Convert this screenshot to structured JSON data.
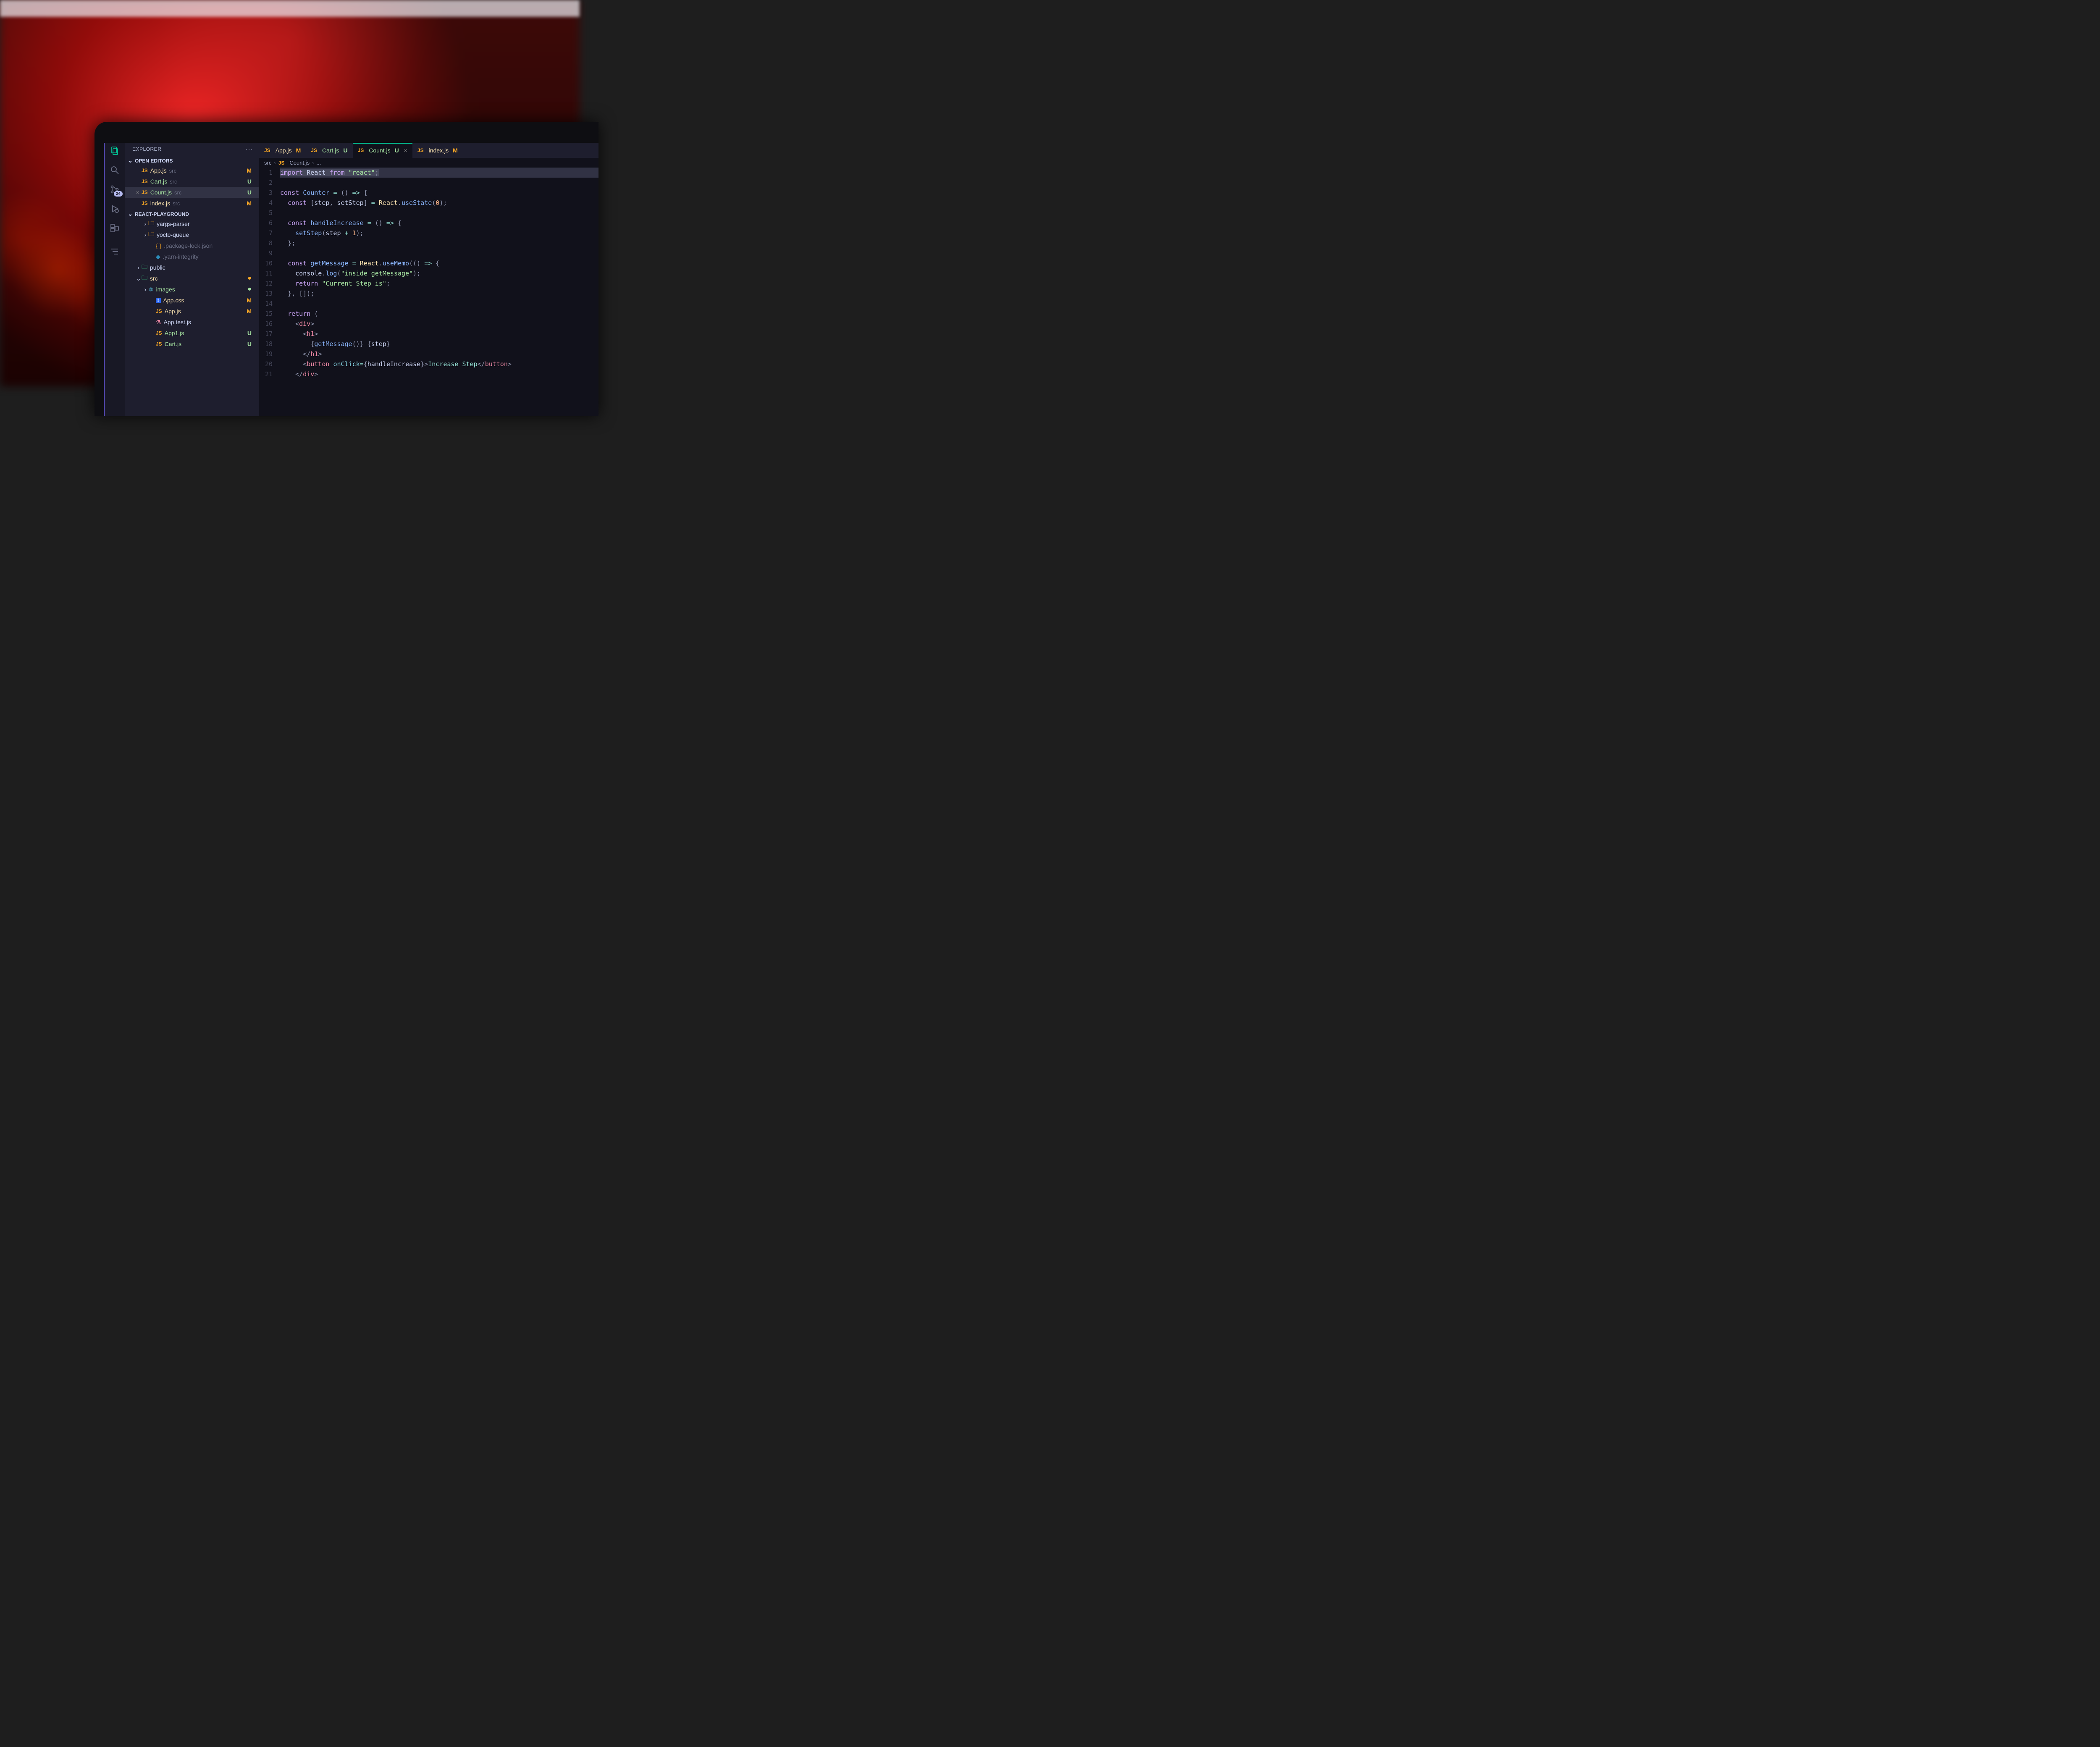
{
  "sidebar": {
    "title": "EXPLORER",
    "openEditorsLabel": "OPEN EDITORS",
    "projectLabel": "REACT-PLAYGROUND",
    "scmBadge": "24",
    "openEditors": [
      {
        "icon": "JS",
        "name": "App.js",
        "dir": "src",
        "status": "M",
        "statusClass": "st-M",
        "nameClass": "fname-yellow"
      },
      {
        "icon": "JS",
        "name": "Cart.js",
        "dir": "src",
        "status": "U",
        "statusClass": "st-U",
        "nameClass": "fname-green"
      },
      {
        "icon": "JS",
        "name": "Count.js",
        "dir": "src",
        "status": "U",
        "statusClass": "st-U",
        "nameClass": "fname-green",
        "selected": true,
        "closeX": true
      },
      {
        "icon": "JS",
        "name": "index.js",
        "dir": "src",
        "status": "M",
        "statusClass": "st-M",
        "nameClass": "fname-yellow"
      }
    ],
    "tree": [
      {
        "indent": 24,
        "chev": "›",
        "iconType": "folder",
        "name": "yargs-parser",
        "nameClass": "fname-default"
      },
      {
        "indent": 24,
        "chev": "›",
        "iconType": "folder",
        "name": "yocto-queue",
        "nameClass": "fname-default"
      },
      {
        "indent": 42,
        "iconType": "braces",
        "name": ".package-lock.json",
        "nameClass": "fname-dim"
      },
      {
        "indent": 42,
        "iconType": "yarn",
        "name": ".yarn-integrity",
        "nameClass": "fname-dim"
      },
      {
        "indent": 8,
        "chev": "›",
        "iconType": "folder-green",
        "name": "public",
        "nameClass": "fname-default"
      },
      {
        "indent": 8,
        "chev": "⌄",
        "iconType": "folder-green",
        "name": "src",
        "nameClass": "fname-yellow",
        "status": "●",
        "statusClass": "st-dot-y"
      },
      {
        "indent": 24,
        "chev": "›",
        "iconType": "react",
        "name": "images",
        "nameClass": "fname-green",
        "status": "●",
        "statusClass": "st-dot-g"
      },
      {
        "indent": 42,
        "iconType": "css",
        "name": "App.css",
        "nameClass": "fname-yellow",
        "status": "M",
        "statusClass": "st-M"
      },
      {
        "indent": 42,
        "iconType": "js",
        "name": "App.js",
        "nameClass": "fname-yellow",
        "status": "M",
        "statusClass": "st-M"
      },
      {
        "indent": 42,
        "iconType": "test",
        "name": "App.test.js",
        "nameClass": "fname-default"
      },
      {
        "indent": 42,
        "iconType": "js",
        "name": "App1.js",
        "nameClass": "fname-green",
        "status": "U",
        "statusClass": "st-U"
      },
      {
        "indent": 42,
        "iconType": "js",
        "name": "Cart.js",
        "nameClass": "fname-green",
        "status": "U",
        "statusClass": "st-U"
      }
    ]
  },
  "tabs": [
    {
      "icon": "JS",
      "name": "App.js",
      "status": "M",
      "statusClass": "st-M",
      "nameClass": "fname-yellow"
    },
    {
      "icon": "JS",
      "name": "Cart.js",
      "status": "U",
      "statusClass": "st-U",
      "nameClass": "fname-green"
    },
    {
      "icon": "JS",
      "name": "Count.js",
      "status": "U",
      "statusClass": "st-U",
      "nameClass": "fname-green",
      "active": true,
      "closeX": true
    },
    {
      "icon": "JS",
      "name": "index.js",
      "status": "M",
      "statusClass": "st-M",
      "nameClass": "fname-yellow"
    }
  ],
  "breadcrumb": {
    "dir": "src",
    "icon": "JS",
    "file": "Count.js",
    "tail": "..."
  },
  "code": {
    "lines": [
      "<span class='cursor-sel'><span class='tk-kw'>import</span> <span class='tk-var'>React</span> <span class='tk-kw'>from</span> <span class='tk-str'>\"react\"</span><span class='tk-punc'>;</span></span>",
      "",
      "<span class='tk-kw'>const</span> <span class='tk-fn'>Counter</span> <span class='tk-op'>=</span> <span class='tk-punc'>()</span> <span class='tk-op'>=&gt;</span> <span class='tk-punc'>{</span>",
      "  <span class='tk-kw'>const</span> <span class='tk-punc'>[</span><span class='tk-var'>step</span><span class='tk-punc'>,</span> <span class='tk-var'>setStep</span><span class='tk-punc'>]</span> <span class='tk-op'>=</span> <span class='tk-React'>React</span><span class='tk-punc'>.</span><span class='tk-call'>useState</span><span class='tk-punc'>(</span><span class='tk-num'>0</span><span class='tk-punc'>);</span>",
      "",
      "  <span class='tk-kw'>const</span> <span class='tk-fn'>handleIncrease</span> <span class='tk-op'>=</span> <span class='tk-punc'>()</span> <span class='tk-op'>=&gt;</span> <span class='tk-punc'>{</span>",
      "    <span class='tk-call'>setStep</span><span class='tk-punc'>(</span><span class='tk-var'>step</span> <span class='tk-op'>+</span> <span class='tk-num'>1</span><span class='tk-punc'>);</span>",
      "  <span class='tk-punc'>};</span>",
      "",
      "  <span class='tk-kw'>const</span> <span class='tk-fn'>getMessage</span> <span class='tk-op'>=</span> <span class='tk-React'>React</span><span class='tk-punc'>.</span><span class='tk-call'>useMemo</span><span class='tk-punc'>(</span><span class='tk-punc'>()</span> <span class='tk-op'>=&gt;</span> <span class='tk-punc'>{</span>",
      "    <span class='tk-var'>console</span><span class='tk-punc'>.</span><span class='tk-call'>log</span><span class='tk-punc'>(</span><span class='tk-str'>\"inside getMessage\"</span><span class='tk-punc'>);</span>",
      "    <span class='tk-kw'>return</span> <span class='tk-str'>\"Current Step is\"</span><span class='tk-punc'>;</span>",
      "  <span class='tk-punc'>},</span> <span class='tk-punc'>[]);</span>",
      "",
      "  <span class='tk-kw'>return</span> <span class='tk-punc'>(</span>",
      "    <span class='tk-tagp'>&lt;</span><span class='tk-tag'>div</span><span class='tk-tagp'>&gt;</span>",
      "      <span class='tk-tagp'>&lt;</span><span class='tk-tag'>h1</span><span class='tk-tagp'>&gt;</span>",
      "        <span class='tk-punc'>{</span><span class='tk-call'>getMessage</span><span class='tk-punc'>()}</span> <span class='tk-punc'>{</span><span class='tk-var'>step</span><span class='tk-punc'>}</span>",
      "      <span class='tk-tagp'>&lt;/</span><span class='tk-tag'>h1</span><span class='tk-tagp'>&gt;</span>",
      "      <span class='tk-tagp'>&lt;</span><span class='tk-tag'>button</span> <span class='tk-attr'>onClick</span><span class='tk-op'>=</span><span class='tk-punc'>{</span><span class='tk-var'>handleIncrease</span><span class='tk-punc'>}</span><span class='tk-tagp'>&gt;</span><span class='tk-prop'>Increase Step</span><span class='tk-tagp'>&lt;/</span><span class='tk-tag'>button</span><span class='tk-tagp'>&gt;</span>",
      "    <span class='tk-tagp'>&lt;/</span><span class='tk-tag'>div</span><span class='tk-tagp'>&gt;</span>"
    ]
  }
}
